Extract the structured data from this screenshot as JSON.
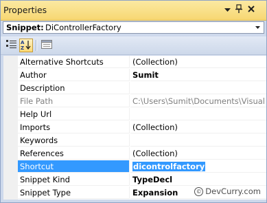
{
  "window": {
    "title": "Properties"
  },
  "selector": {
    "label": "Snippet:",
    "value": "DiControllerFactory"
  },
  "rows": [
    {
      "name": "Alternative Shortcuts",
      "value": "(Collection)",
      "name_style": "",
      "value_style": ""
    },
    {
      "name": "Author",
      "value": "Sumit",
      "name_style": "",
      "value_style": "bold"
    },
    {
      "name": "Description",
      "value": "",
      "name_style": "",
      "value_style": ""
    },
    {
      "name": "File Path",
      "value": "C:\\Users\\Sumit\\Documents\\Visual St",
      "name_style": "gray",
      "value_style": "gray"
    },
    {
      "name": "Help Url",
      "value": "",
      "name_style": "",
      "value_style": ""
    },
    {
      "name": "Imports",
      "value": "(Collection)",
      "name_style": "",
      "value_style": ""
    },
    {
      "name": "Keywords",
      "value": "",
      "name_style": "",
      "value_style": ""
    },
    {
      "name": "References",
      "value": "(Collection)",
      "name_style": "",
      "value_style": ""
    },
    {
      "name": "Shortcut",
      "value": "dicontrolfactory",
      "name_style": "",
      "value_style": "bold",
      "selected": true
    },
    {
      "name": "Snippet Kind",
      "value": "TypeDecl",
      "name_style": "",
      "value_style": "bold"
    },
    {
      "name": "Snippet Type",
      "value": "Expansion",
      "name_style": "",
      "value_style": "bold"
    }
  ],
  "watermark": {
    "symbol": "©",
    "text": "DevCurry.com"
  },
  "icons": {
    "pin": "pin-icon",
    "dropdown": "chevron-down-icon",
    "close": "close-icon",
    "categorized": "categorized-icon",
    "alphabetical": "alphabetical-sort-icon",
    "property_pages": "property-pages-icon"
  },
  "colors": {
    "title_bar": "#f7d772",
    "selection": "#3399ff",
    "panel": "#ced9ec"
  }
}
